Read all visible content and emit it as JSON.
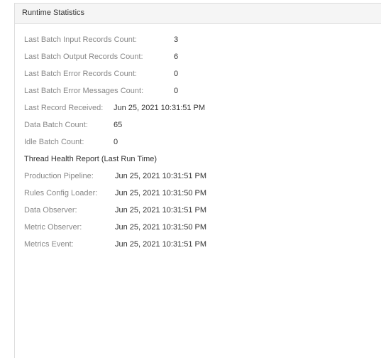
{
  "panel": {
    "title": "Runtime Statistics"
  },
  "stats": [
    {
      "label": "Last Batch Input Records Count:",
      "value": "3"
    },
    {
      "label": "Last Batch Output Records Count:",
      "value": "6"
    },
    {
      "label": "Last Batch Error Records Count:",
      "value": "0"
    },
    {
      "label": "Last Batch Error Messages Count:",
      "value": "0"
    },
    {
      "label": "Last Record Received:",
      "value": "Jun 25, 2021 10:31:51 PM"
    },
    {
      "label": "Data Batch Count:",
      "value": "65"
    },
    {
      "label": "Idle Batch Count:",
      "value": "0"
    }
  ],
  "thread_health": {
    "title": "Thread Health Report (Last Run Time)",
    "items": [
      {
        "label": "Production Pipeline:",
        "value": "Jun 25, 2021 10:31:51 PM"
      },
      {
        "label": "Rules Config Loader:",
        "value": "Jun 25, 2021 10:31:50 PM"
      },
      {
        "label": "Data Observer:",
        "value": "Jun 25, 2021 10:31:51 PM"
      },
      {
        "label": "Metric Observer:",
        "value": "Jun 25, 2021 10:31:50 PM"
      },
      {
        "label": "Metrics Event:",
        "value": "Jun 25, 2021 10:31:51 PM"
      }
    ]
  }
}
